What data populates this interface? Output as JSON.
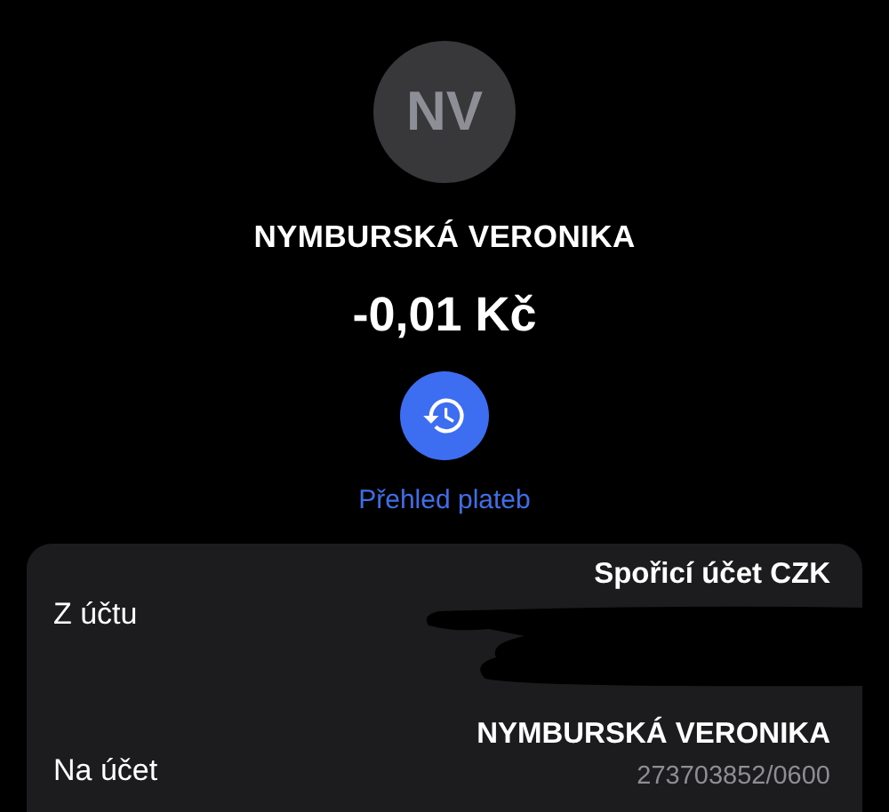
{
  "header": {
    "avatar_initials": "NV",
    "name": "NYMBURSKÁ VERONIKA",
    "amount": "-0,01 Kč",
    "history_link": "Přehled plateb"
  },
  "details": [
    {
      "label": "Z účtu",
      "value": "Spořicí účet CZK",
      "redacted": true
    },
    {
      "label": "Na účet",
      "value": "NYMBURSKÁ VERONIKA",
      "sub": "273703852/0600",
      "redacted": false
    }
  ]
}
